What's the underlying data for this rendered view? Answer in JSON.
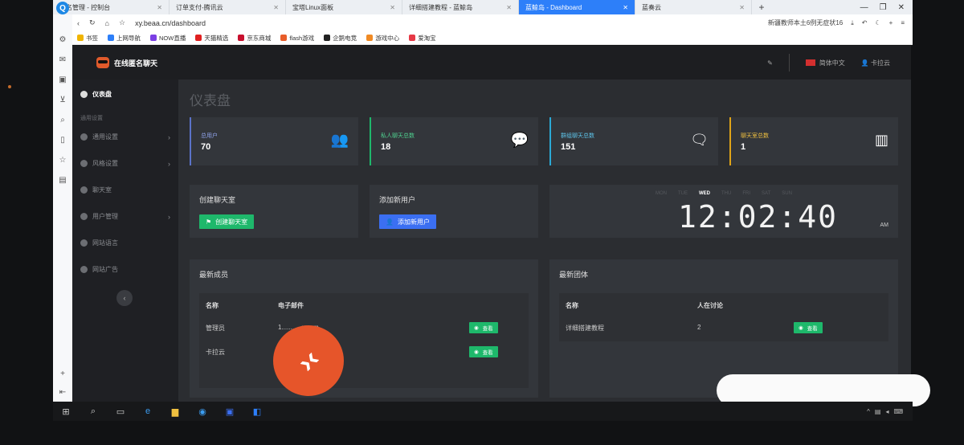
{
  "browser": {
    "tabs": [
      {
        "label": "域名管理 - 控制台"
      },
      {
        "label": "订单支付-腾讯云"
      },
      {
        "label": "宝塔Linux面板"
      },
      {
        "label": "详细搭建教程 - 蓝鲸岛"
      },
      {
        "label": "蓝鲸岛 - Dashboard"
      },
      {
        "label": "蓝奏云"
      }
    ],
    "url": "xy.beaa.cn/dashboard",
    "news": "新疆教师本土6例无症状16",
    "bookmarks": [
      "书签",
      "上网导航",
      "NOW直播",
      "天猫精选",
      "京东商城",
      "flash游戏",
      "企鹅电竞",
      "游戏中心",
      "爱淘宝"
    ]
  },
  "app": {
    "brand": "在线匿名聊天",
    "language": "简体中文",
    "username": "卡拉云",
    "sidebar": {
      "dashboard": "仪表盘",
      "group": "通用设置",
      "items": [
        {
          "label": "通用设置",
          "has_children": true
        },
        {
          "label": "风格设置",
          "has_children": true
        },
        {
          "label": "聊天室",
          "has_children": false
        },
        {
          "label": "用户管理",
          "has_children": true
        },
        {
          "label": "网站语言",
          "has_children": false
        },
        {
          "label": "网站广告",
          "has_children": false
        }
      ]
    },
    "page_title": "仪表盘",
    "stats": [
      {
        "label": "总用户",
        "value": "70",
        "color": "#5b73c9",
        "icon": "users-icon"
      },
      {
        "label": "私人聊天总数",
        "value": "18",
        "color": "#1eb86b",
        "icon": "chat-icon"
      },
      {
        "label": "群组聊天总数",
        "value": "151",
        "color": "#2ba9d6",
        "icon": "chats-icon"
      },
      {
        "label": "聊天室总数",
        "value": "1",
        "color": "#e0a418",
        "icon": "rooms-icon"
      }
    ],
    "create_room": {
      "title": "创建聊天室",
      "button": "创建聊天室"
    },
    "add_user": {
      "title": "添加新用户",
      "button": "添加新用户"
    },
    "clock": {
      "days": [
        "MON",
        "TUE",
        "WED",
        "THU",
        "FRI",
        "SAT",
        "SUN"
      ],
      "active_day": "WED",
      "time": "12:02:40",
      "ampm": "AM"
    },
    "members": {
      "title": "最新成员",
      "headers": [
        "名称",
        "电子邮件"
      ],
      "rows": [
        {
          "name": "管理员",
          "email": "1...........q.com",
          "action": "查看"
        },
        {
          "name": "卡拉云",
          "email": "",
          "action": "查看"
        }
      ]
    },
    "groups": {
      "title": "最新团体",
      "headers": [
        "名称",
        "人在讨论"
      ],
      "rows": [
        {
          "name": "详细搭建教程",
          "count": "2",
          "action": "查看"
        }
      ]
    }
  }
}
